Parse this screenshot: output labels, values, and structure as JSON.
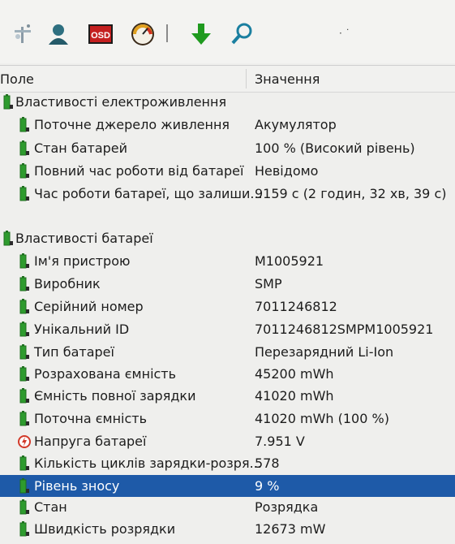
{
  "toolbar": {
    "icons": [
      "network-tool-icon",
      "user-icon",
      "osd-icon",
      "gauge-icon",
      "download-arrow-icon",
      "search-icon"
    ],
    "osd_label": "OSD",
    "dots": "· ˙"
  },
  "header": {
    "field": "Поле",
    "value": "Значення"
  },
  "sections": [
    {
      "title": "Властивості електроживлення",
      "rows": [
        {
          "name": "Поточне джерело живлення",
          "value": "Акумулятор"
        },
        {
          "name": "Стан батарей",
          "value": "100 % (Високий рівень)"
        },
        {
          "name": "Повний час роботи від батареї",
          "value": "Невідомо"
        },
        {
          "name": "Час роботи батареї, що залиши...",
          "value": "9159 с (2 годин, 32 хв, 39 с)"
        }
      ]
    },
    {
      "title": "Властивості батареї",
      "rows": [
        {
          "name": "Ім'я пристрою",
          "value": "M1005921"
        },
        {
          "name": "Виробник",
          "value": "SMP"
        },
        {
          "name": "Серійний номер",
          "value": "7011246812"
        },
        {
          "name": "Унікальний ID",
          "value": "7011246812SMPM1005921"
        },
        {
          "name": "Тип батареї",
          "value": "Перезарядний Li-Ion"
        },
        {
          "name": "Розрахована ємність",
          "value": "45200 mWh"
        },
        {
          "name": "Ємність повної зарядки",
          "value": "41020 mWh"
        },
        {
          "name": "Поточна ємність",
          "value": "41020 mWh  (100 %)"
        },
        {
          "name": "Напруга батареї",
          "value": "7.951 V"
        },
        {
          "name": "Кількість циклів зарядки-розря...",
          "value": "578"
        },
        {
          "name": "Рівень зносу",
          "value": "9 %"
        },
        {
          "name": "Стан",
          "value": "Розрядка"
        },
        {
          "name": "Швидкість розрядки",
          "value": "12673 mW"
        }
      ]
    }
  ],
  "colors": {
    "selection": "#1e5aa8",
    "battery_green": "#2e9b2e",
    "voltage_red": "#d23a2a"
  }
}
